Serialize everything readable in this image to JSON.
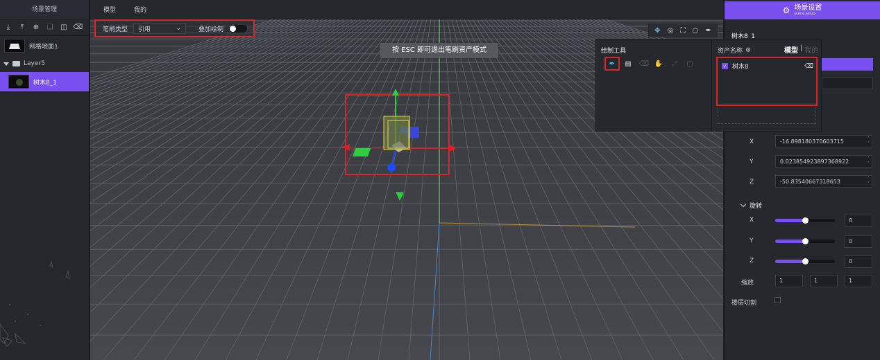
{
  "left_panel": {
    "header": "场景管理",
    "toolbar_icons": [
      "download-icon",
      "upload-icon",
      "target-icon",
      "copy-icon",
      "lock-icon",
      "trash-icon"
    ],
    "items": [
      {
        "label": "网格地面1",
        "thumb": "ground"
      },
      {
        "label": "Layer5",
        "type": "folder"
      },
      {
        "label": "树木8_1",
        "thumb": "tree",
        "selected": true
      }
    ]
  },
  "top_tabs": [
    "模型",
    "我的"
  ],
  "brush_bar": {
    "type_label": "笔刷类型",
    "type_value": "引用",
    "overlay_label": "叠加绘制",
    "overlay_on": false
  },
  "esc_hint": "按 ESC 即可退出笔刷资产模式",
  "gizmo_tools": [
    "move-icon",
    "rotate-icon",
    "scale-icon",
    "circle-icon",
    "brush-icon"
  ],
  "draw_panel": {
    "title": "绘制工具",
    "asset_name_label": "资产名称",
    "tab_model": "模型",
    "tab_sep": "|",
    "tab_other": "我的",
    "asset_item": "树木8"
  },
  "right_panel": {
    "setup_title": "场景设置",
    "setup_subtitle": "scene setup",
    "object_title": "树木8_1",
    "position": {
      "x": "-16.898180370603715",
      "y": "0.023854923897368922",
      "z": "-50.83540667318653"
    },
    "rotation_label": "旋转",
    "rotation": {
      "x": {
        "value": "0",
        "fraction": 0.5
      },
      "y": {
        "value": "0",
        "fraction": 0.5
      },
      "z": {
        "value": "0",
        "fraction": 0.5
      }
    },
    "axis_labels": {
      "x": "X",
      "y": "Y",
      "z": "Z"
    },
    "scale_label": "缩放",
    "scale": [
      "1",
      "1",
      "1"
    ],
    "cut_label": "楼层切割"
  },
  "colors": {
    "accent": "#7a4ff0",
    "highlight_box": "#d12a2a"
  }
}
